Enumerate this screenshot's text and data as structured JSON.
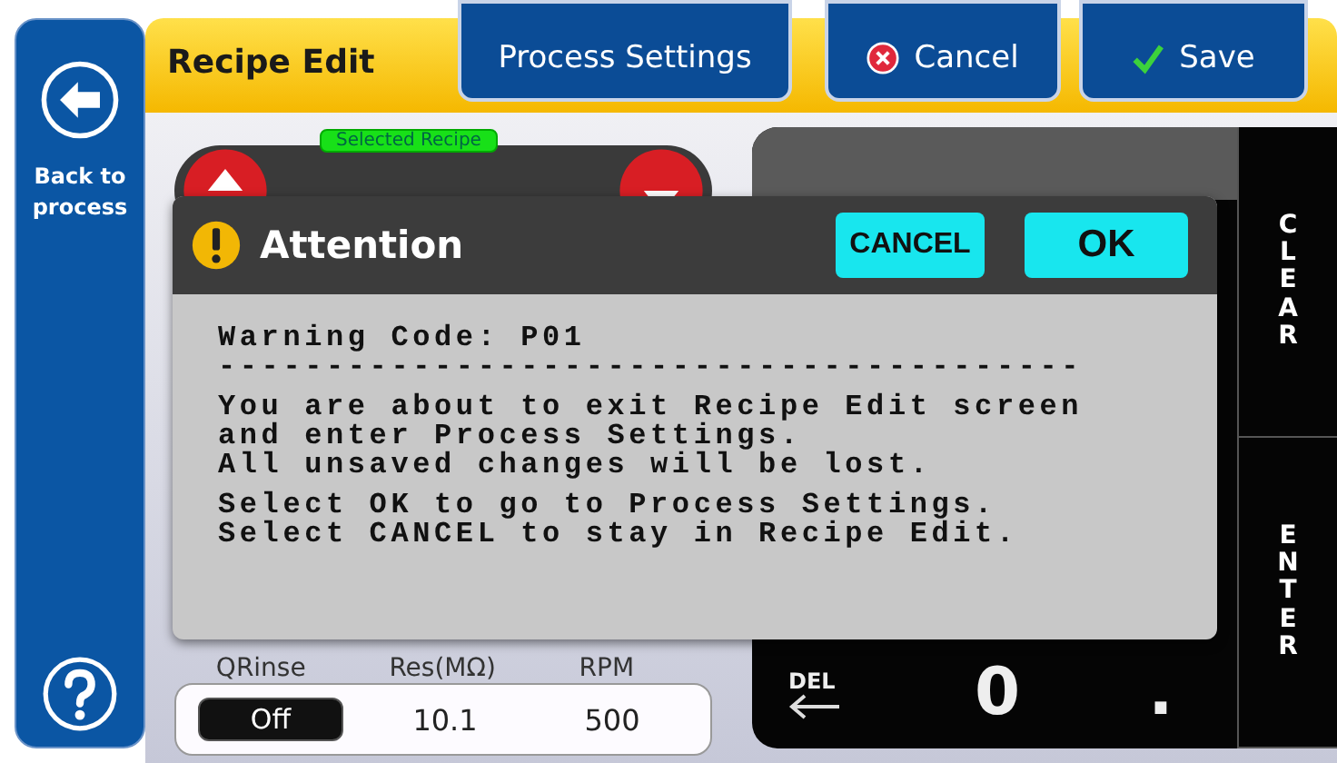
{
  "sidebar": {
    "back_label": "Back to process"
  },
  "header": {
    "title": "Recipe Edit",
    "buttons": [
      {
        "label": "Process Settings",
        "kind": "plain"
      },
      {
        "label": "Cancel",
        "kind": "cancel"
      },
      {
        "label": "Save",
        "kind": "save"
      }
    ]
  },
  "recipe_selector": {
    "badge": "Selected Recipe"
  },
  "parameters": {
    "columns": [
      "QRinse",
      "Res(MΩ)",
      "RPM"
    ],
    "values": [
      {
        "text": "Off",
        "kind": "toggle"
      },
      {
        "text": "10.1",
        "kind": "value"
      },
      {
        "text": "500",
        "kind": "value"
      }
    ]
  },
  "keypad": {
    "bottom_keys": [
      {
        "kind": "del",
        "label": "DEL"
      },
      {
        "kind": "digit",
        "label": "0"
      },
      {
        "kind": "digit",
        "label": "."
      }
    ],
    "side_keys": [
      "CLEAR",
      "ENTER"
    ]
  },
  "dialog": {
    "title": "Attention",
    "buttons": [
      {
        "label": "CANCEL",
        "kind": "secondary"
      },
      {
        "label": "OK",
        "kind": "primary"
      }
    ],
    "paragraphs": [
      [
        "Warning Code: P01",
        "----------------------------------------"
      ],
      [
        "You are about to exit Recipe Edit screen",
        "and enter Process Settings.",
        "All unsaved changes will be lost."
      ],
      [
        "Select OK to go to Process Settings.",
        "Select CANCEL to stay in Recipe Edit."
      ]
    ]
  }
}
